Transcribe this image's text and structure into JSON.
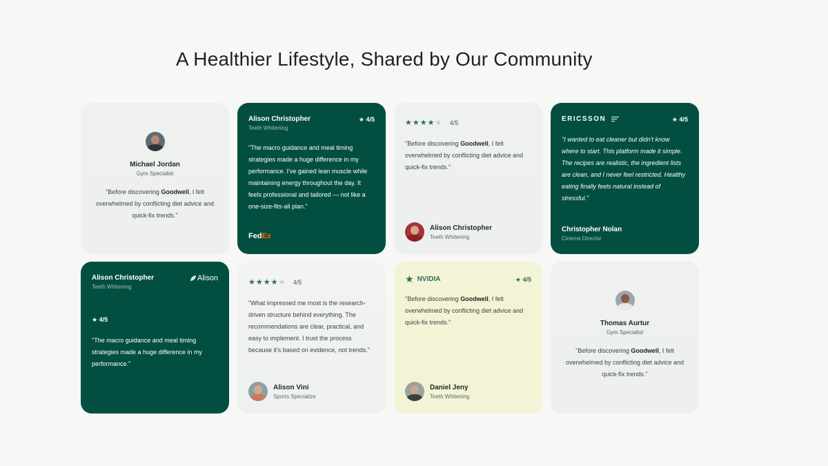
{
  "title": "A Healthier Lifestyle, Shared by Our Community",
  "colors": {
    "dark_green": "#024f41",
    "star": "#2f6b57",
    "cream": "#f3f3d6",
    "fedex_orange": "#ff6200"
  },
  "cards": [
    {
      "name": "Michael Jordan",
      "role": "Gym Specialist",
      "quote_pre": "\"Before discovering ",
      "brand_word": "Goodwell",
      "quote_post": ", I felt overwhelmed by conflicting diet advice and quick-fix trends.\""
    },
    {
      "name": "Alison Christopher",
      "role": "Teeth Whitening",
      "rating": "★ 4/5",
      "quote": "\"The macro guidance and meal timing strategies made a huge difference in my performance. I've gained lean muscle while maintaining energy throughout the day. It feels professional and tailored — not like a one-size-fits-all plan.\"",
      "logo_a": "Fed",
      "logo_b": "Ex"
    },
    {
      "stars": "★★★★",
      "star_off": "★",
      "score": "4/5",
      "quote_pre": "\"Before discovering ",
      "brand_word": "Goodwell",
      "quote_post": ", I felt overwhelmed by conflicting diet advice and quick-fix trends.\"",
      "name": "Alison Christopher",
      "role": "Teeth Whitening"
    },
    {
      "logo": "ERICSSON",
      "logo_icon": "menu-icon",
      "rating": "★ 4/5",
      "quote": "\"I wanted to eat cleaner but didn't know where to start. This platform made it simple. The recipes are realistic, the ingredient lists are clean, and I never feel restricted. Healthy eating finally feels natural instead of stressful.\"",
      "name": "Christopher Nolan",
      "role": "Cinema Director"
    },
    {
      "name": "Alison Christopher",
      "role": "Teeth Whitening",
      "logo": "Alison",
      "rating": "★ 4/5",
      "quote": "\"The macro guidance and meal timing strategies made a huge difference in my performance.\""
    },
    {
      "stars": "★★★★",
      "star_off": "★",
      "score": "4/5",
      "quote": "\"What impressed me most is the research-driven structure behind everything. The recommendations are clear, practical, and easy to implement. I trust the process because it's based on evidence, not trends.\"",
      "name": "Alison Vini",
      "role": "Sports Specialize"
    },
    {
      "logo_icon": "star-icon",
      "logo": "NVIDIA",
      "rating": "★ 4/5",
      "quote_pre": "\"Before discovering ",
      "brand_word": "Goodwell",
      "quote_post": ", I felt overwhelmed by conflicting diet advice and quick-fix trends.\"",
      "name": "Daniel Jeny",
      "role": "Teeth Whitening"
    },
    {
      "name": "Thomas Aurtur",
      "role": "Gym Specialist",
      "quote_pre": "\"Before discovering ",
      "brand_word": "Goodwell",
      "quote_post": ", I felt overwhelmed by conflicting diet advice and quick-fix trends.\""
    }
  ]
}
